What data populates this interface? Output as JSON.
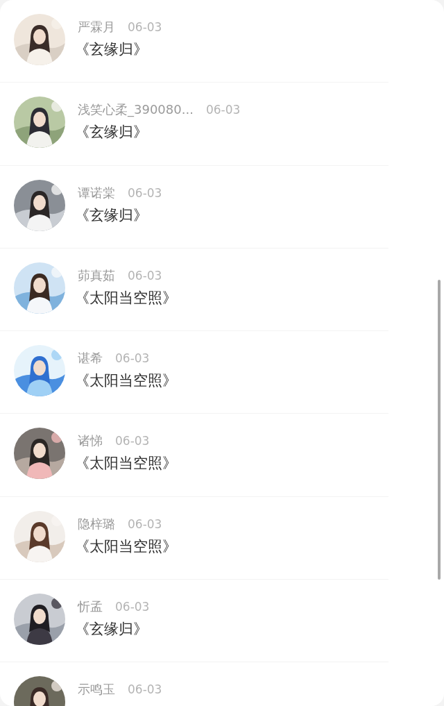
{
  "entries": [
    {
      "name": "严霖月",
      "date": "06-03",
      "title": "《玄缘归》"
    },
    {
      "name": "浅笑心柔_390080...",
      "date": "06-03",
      "title": "《玄缘归》"
    },
    {
      "name": "谭诺棠",
      "date": "06-03",
      "title": "《玄缘归》"
    },
    {
      "name": "茆真茹",
      "date": "06-03",
      "title": "《太阳当空照》"
    },
    {
      "name": "谌希",
      "date": "06-03",
      "title": "《太阳当空照》"
    },
    {
      "name": "诸悌",
      "date": "06-03",
      "title": "《太阳当空照》"
    },
    {
      "name": "隐梓璐",
      "date": "06-03",
      "title": "《太阳当空照》"
    },
    {
      "name": "忻孟",
      "date": "06-03",
      "title": "《玄缘归》"
    },
    {
      "name": "示鸣玉",
      "date": "06-03"
    }
  ]
}
